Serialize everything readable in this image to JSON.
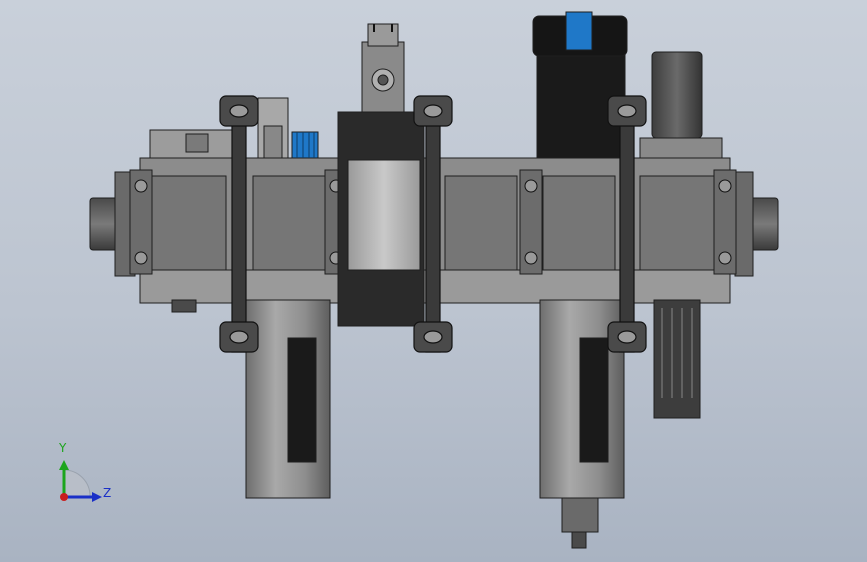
{
  "triad": {
    "y_axis_label": "Y",
    "z_axis_label": "Z",
    "y_color": "#1ca51c",
    "z_color": "#1a2fc7",
    "origin_color": "#c81e1e"
  },
  "colors": {
    "body_gray": "#8c8c8c",
    "body_dark": "#5f5f5f",
    "outline": "#1e1e1e",
    "black_part": "#1a1a1a",
    "blue_accent": "#1f78c8"
  }
}
